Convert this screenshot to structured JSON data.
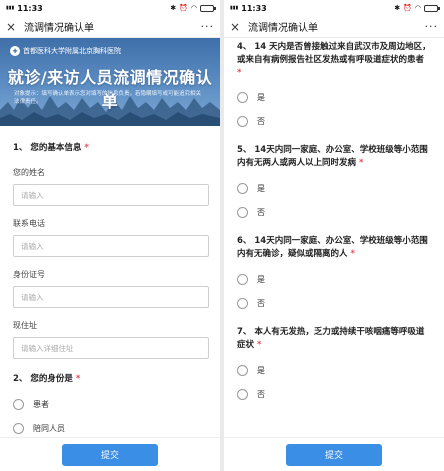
{
  "status_bar": {
    "time": "11:33",
    "signal": "4G\nHD"
  },
  "window": {
    "title": "流调情况确认单",
    "close_icon": "×",
    "more_icon": "···"
  },
  "banner": {
    "hospital_name": "首都医科大学附属北京胸科医院",
    "title": "就诊/来访人员流调情况确认单",
    "subtitle": "对象提示：填写确认单表示您对填写的信息负责，若隐瞒填写或可能追究相关法律责任。"
  },
  "form_left": {
    "q1": {
      "number": "1、",
      "title": "您的基本信息"
    },
    "fields": [
      {
        "label": "您的姓名",
        "placeholder": "请输入"
      },
      {
        "label": "联系电话",
        "placeholder": "请输入"
      },
      {
        "label": "身份证号",
        "placeholder": "请输入"
      },
      {
        "label": "现住址",
        "placeholder": "请输入详细住址"
      }
    ],
    "q2": {
      "number": "2、",
      "title": "您的身份是",
      "options": [
        "患者",
        "陪同人员"
      ]
    }
  },
  "form_right": {
    "q4": {
      "title": "4、 14 天内是否曾接触过来自武汉市及周边地区，或来自有病例报告社区发热或有呼吸道症状的患者",
      "options": [
        "是",
        "否"
      ]
    },
    "q5": {
      "title": "5、 14天内同一家庭、办公室、学校班级等小范围内有无两人或两人以上同时发病",
      "options": [
        "是",
        "否"
      ]
    },
    "q6": {
      "title": "6、 14天内同一家庭、办公室、学校班级等小范围内有无确诊，疑似或隔离的人",
      "options": [
        "是",
        "否"
      ]
    },
    "q7": {
      "title": "7、 本人有无发热，乏力或持续干咳咽痛等呼吸道症状",
      "options": [
        "是",
        "否"
      ]
    }
  },
  "required_mark": "*",
  "submit_label": "提交"
}
